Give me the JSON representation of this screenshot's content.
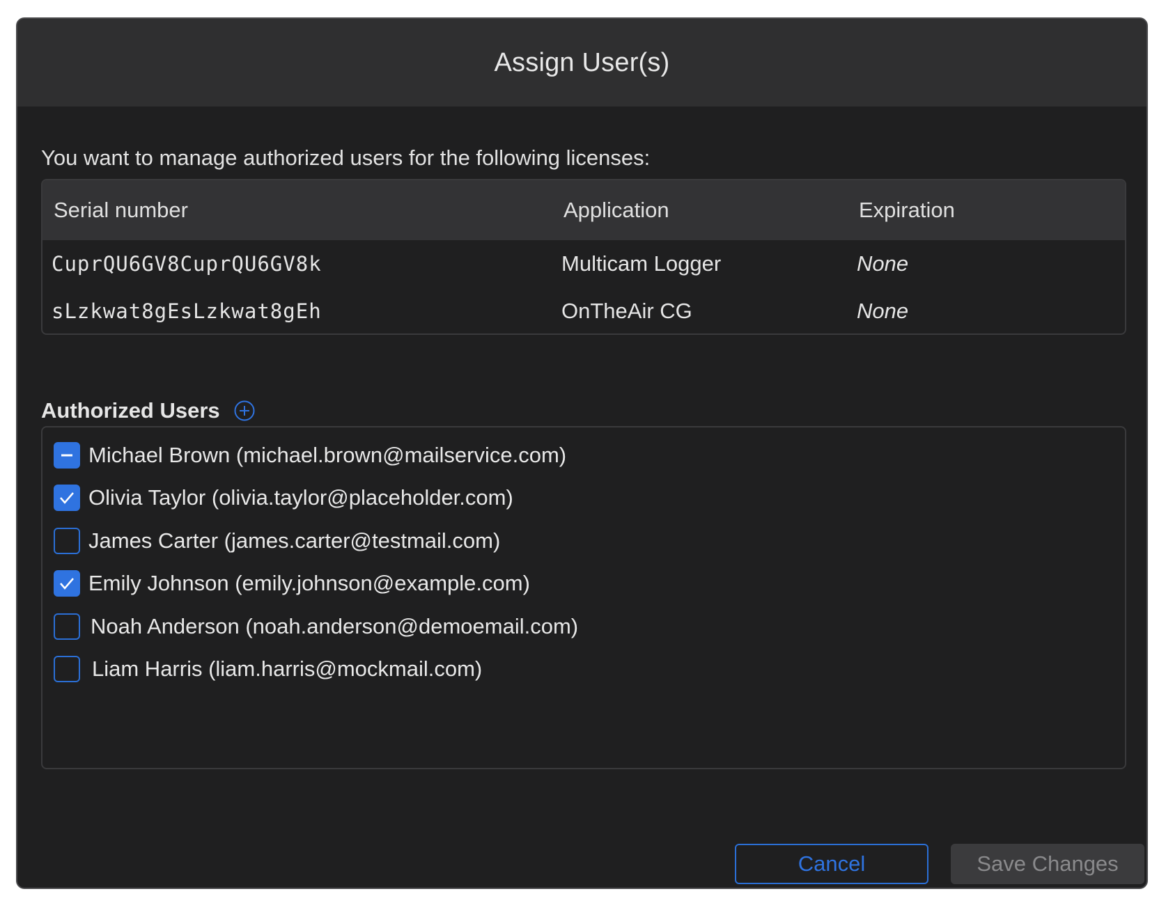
{
  "dialog": {
    "title": "Assign User(s)",
    "intro": "You want to manage authorized users for the following licenses:"
  },
  "licenses": {
    "columns": [
      "Serial number",
      "Application",
      "Expiration"
    ],
    "rows": [
      {
        "serial": "CuprQU6GV8CuprQU6GV8k",
        "application": "Multicam Logger",
        "expiration": "None"
      },
      {
        "serial": "sLzkwat8gEsLzkwat8gEh",
        "application": "OnTheAir CG",
        "expiration": "None"
      }
    ]
  },
  "authorized_users": {
    "title": "Authorized Users",
    "add_icon": "plus-circle-icon",
    "users": [
      {
        "label": "Michael Brown (michael.brown@mailservice.com)",
        "state": "mixed"
      },
      {
        "label": "Olivia Taylor (olivia.taylor@placeholder.com)",
        "state": "checked"
      },
      {
        "label": "James Carter (james.carter@testmail.com)",
        "state": "unchecked"
      },
      {
        "label": "Emily Johnson (emily.johnson@example.com)",
        "state": "checked"
      },
      {
        "label": "Noah Anderson (noah.anderson@demoemail.com)",
        "state": "unchecked"
      },
      {
        "label": "Liam Harris (liam.harris@mockmail.com)",
        "state": "unchecked"
      }
    ]
  },
  "footer": {
    "cancel_label": "Cancel",
    "save_label": "Save Changes"
  },
  "colors": {
    "accent": "#2f73e0",
    "background": "#1f1f20",
    "titlebar": "#2f2f30",
    "disabled_button": "#3b3b3d"
  }
}
